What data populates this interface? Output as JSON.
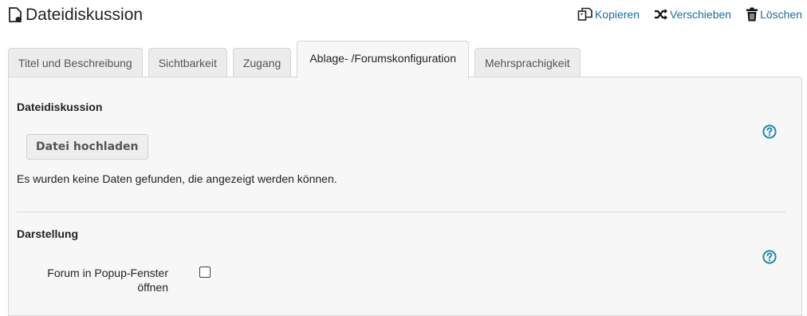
{
  "header": {
    "title": "Dateidiskussion",
    "actions": {
      "copy": "Kopieren",
      "move": "Verschieben",
      "delete": "Löschen"
    }
  },
  "tabs": [
    {
      "label": "Titel und Beschreibung",
      "active": false
    },
    {
      "label": "Sichtbarkeit",
      "active": false
    },
    {
      "label": "Zugang",
      "active": false
    },
    {
      "label": "Ablage- /Forumskonfiguration",
      "active": true
    },
    {
      "label": "Mehrsprachigkeit",
      "active": false
    }
  ],
  "files_section": {
    "title": "Dateidiskussion",
    "upload_button": "Datei hochladen",
    "empty_message": "Es wurden keine Daten gefunden, die angezeigt werden können."
  },
  "display_section": {
    "title": "Darstellung",
    "popup_label": "Forum in Popup-Fenster öffnen",
    "popup_checked": false
  },
  "colors": {
    "link": "#1a6ea0",
    "help_icon": "#1f8aa8",
    "panel_bg": "#f7f7f7",
    "tab_bg": "#ececec"
  },
  "icons": {
    "title": "file-discussion-icon",
    "copy": "copy-icon",
    "move": "shuffle-icon",
    "delete": "trash-icon",
    "help": "help-circle-icon"
  }
}
